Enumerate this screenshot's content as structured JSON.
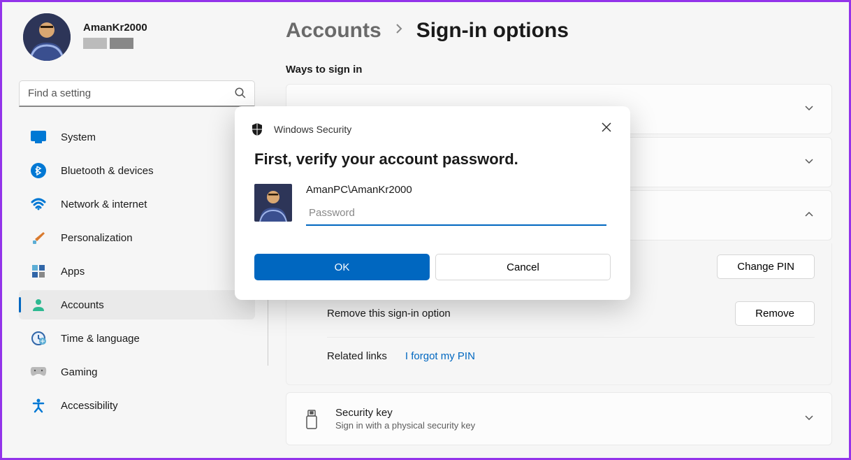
{
  "profile": {
    "username": "AmanKr2000"
  },
  "search": {
    "placeholder": "Find a setting"
  },
  "sidebar": {
    "items": [
      {
        "label": "System"
      },
      {
        "label": "Bluetooth & devices"
      },
      {
        "label": "Network & internet"
      },
      {
        "label": "Personalization"
      },
      {
        "label": "Apps"
      },
      {
        "label": "Accounts"
      },
      {
        "label": "Time & language"
      },
      {
        "label": "Gaming"
      },
      {
        "label": "Accessibility"
      }
    ]
  },
  "breadcrumb": {
    "parent": "Accounts",
    "current": "Sign-in options"
  },
  "section_heading": "Ways to sign in",
  "pin_expanded": {
    "change_label": "Change PIN",
    "remove_label": "Remove this sign-in option",
    "remove_button": "Remove",
    "related_heading": "Related links",
    "forgot_link": "I forgot my PIN"
  },
  "security_key": {
    "title": "Security key",
    "desc": "Sign in with a physical security key"
  },
  "dialog": {
    "title": "Windows Security",
    "heading": "First, verify your account password.",
    "account": "AmanPC\\AmanKr2000",
    "password_placeholder": "Password",
    "ok": "OK",
    "cancel": "Cancel"
  }
}
